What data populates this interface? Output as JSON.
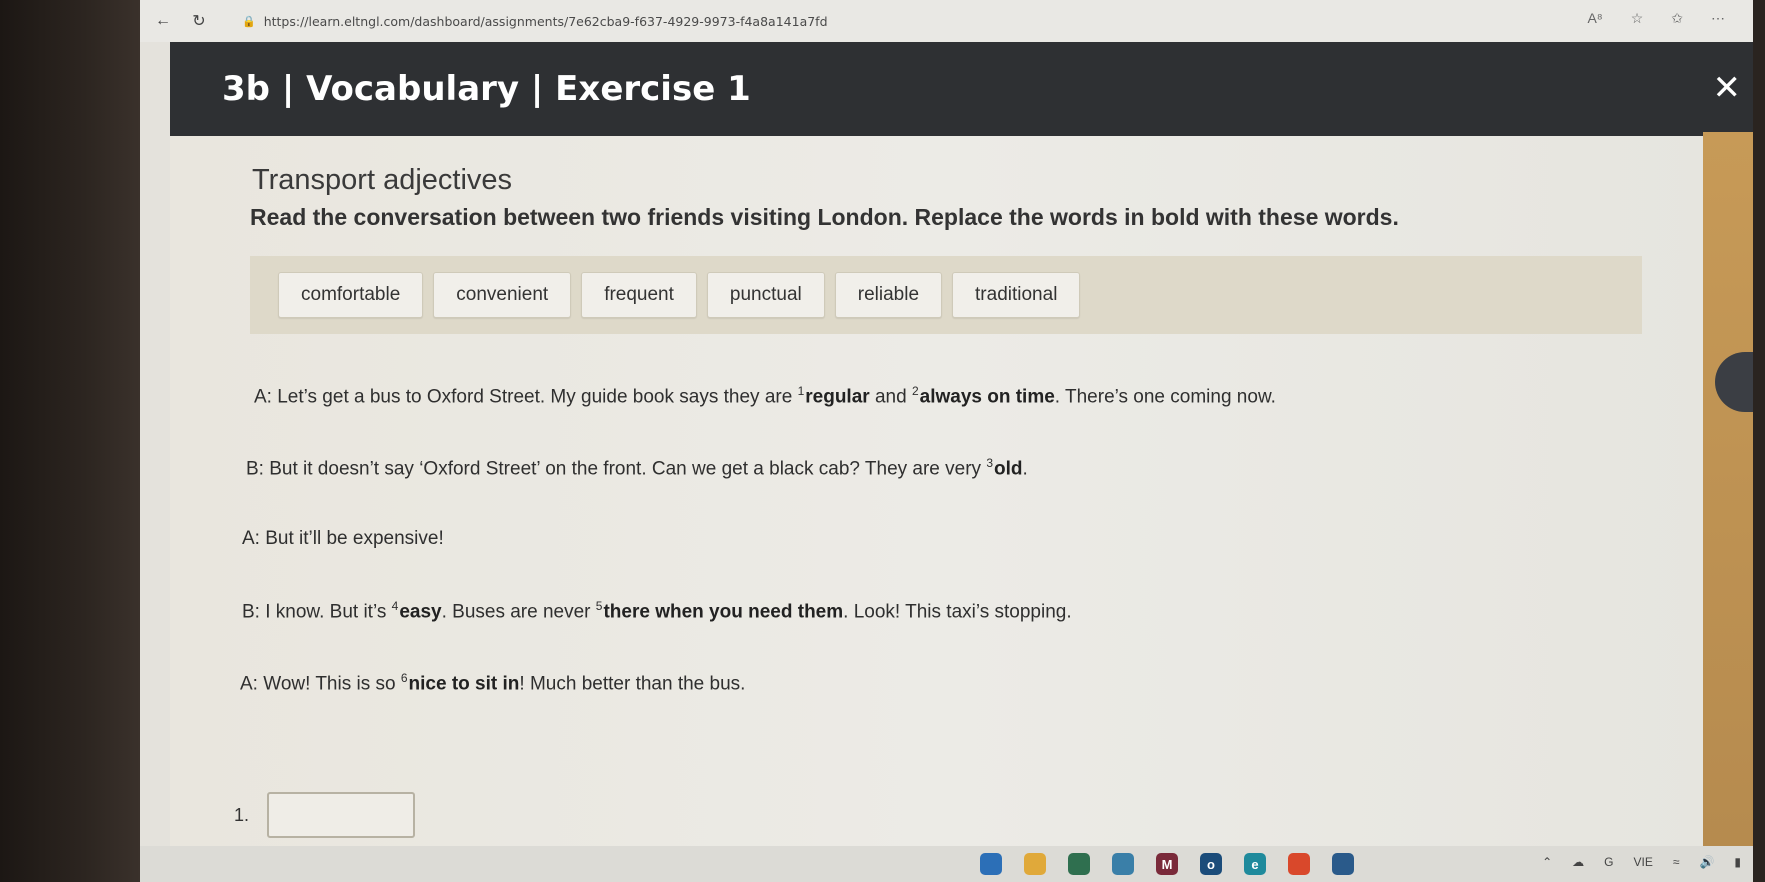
{
  "browser": {
    "url": "https://learn.eltngl.com/dashboard/assignments/7e62cba9-f637-4929-9973-f4a8a141a7fd",
    "back_icon": "arrow-left-icon",
    "refresh_icon": "refresh-icon"
  },
  "header": {
    "title": "3b | Vocabulary | Exercise 1",
    "close_label": "✕"
  },
  "exercise": {
    "subtitle": "Transport adjectives",
    "instruction": "Read the conversation between two friends visiting London. Replace the words in bold with these words.",
    "word_bank": [
      "comfortable",
      "convenient",
      "frequent",
      "punctual",
      "reliable",
      "traditional"
    ],
    "conversation": [
      {
        "speaker": "A:",
        "parts": [
          {
            "t": "Let’s get a bus to Oxford Street. My guide book says they are "
          },
          {
            "sup": "1"
          },
          {
            "b": "regular"
          },
          {
            "t": " and "
          },
          {
            "sup": "2"
          },
          {
            "b": "always on time"
          },
          {
            "t": ". There’s one coming now."
          }
        ]
      },
      {
        "speaker": "B:",
        "parts": [
          {
            "t": "But it doesn’t say ‘Oxford Street’ on the front. Can we get a black cab? They are very "
          },
          {
            "sup": "3"
          },
          {
            "b": "old"
          },
          {
            "t": "."
          }
        ]
      },
      {
        "speaker": "A:",
        "parts": [
          {
            "t": "But it’ll be expensive!"
          }
        ]
      },
      {
        "speaker": "B:",
        "parts": [
          {
            "t": "I know. But it’s "
          },
          {
            "sup": "4"
          },
          {
            "b": "easy"
          },
          {
            "t": ". Buses are never "
          },
          {
            "sup": "5"
          },
          {
            "b": "there when you need them"
          },
          {
            "t": ". Look! This taxi’s stopping."
          }
        ]
      },
      {
        "speaker": "A:",
        "parts": [
          {
            "t": "Wow! This is so "
          },
          {
            "sup": "6"
          },
          {
            "b": "nice to sit in"
          },
          {
            "t": "! Much better than the bus."
          }
        ]
      }
    ],
    "answers": [
      {
        "number": "1.",
        "value": ""
      }
    ]
  },
  "taskbar": {
    "tray_lang": "VIE"
  },
  "colors": {
    "title_bar": "#2e3033",
    "accent_orange": "#c79a57",
    "word_bank_bg": "#ded9c9"
  }
}
